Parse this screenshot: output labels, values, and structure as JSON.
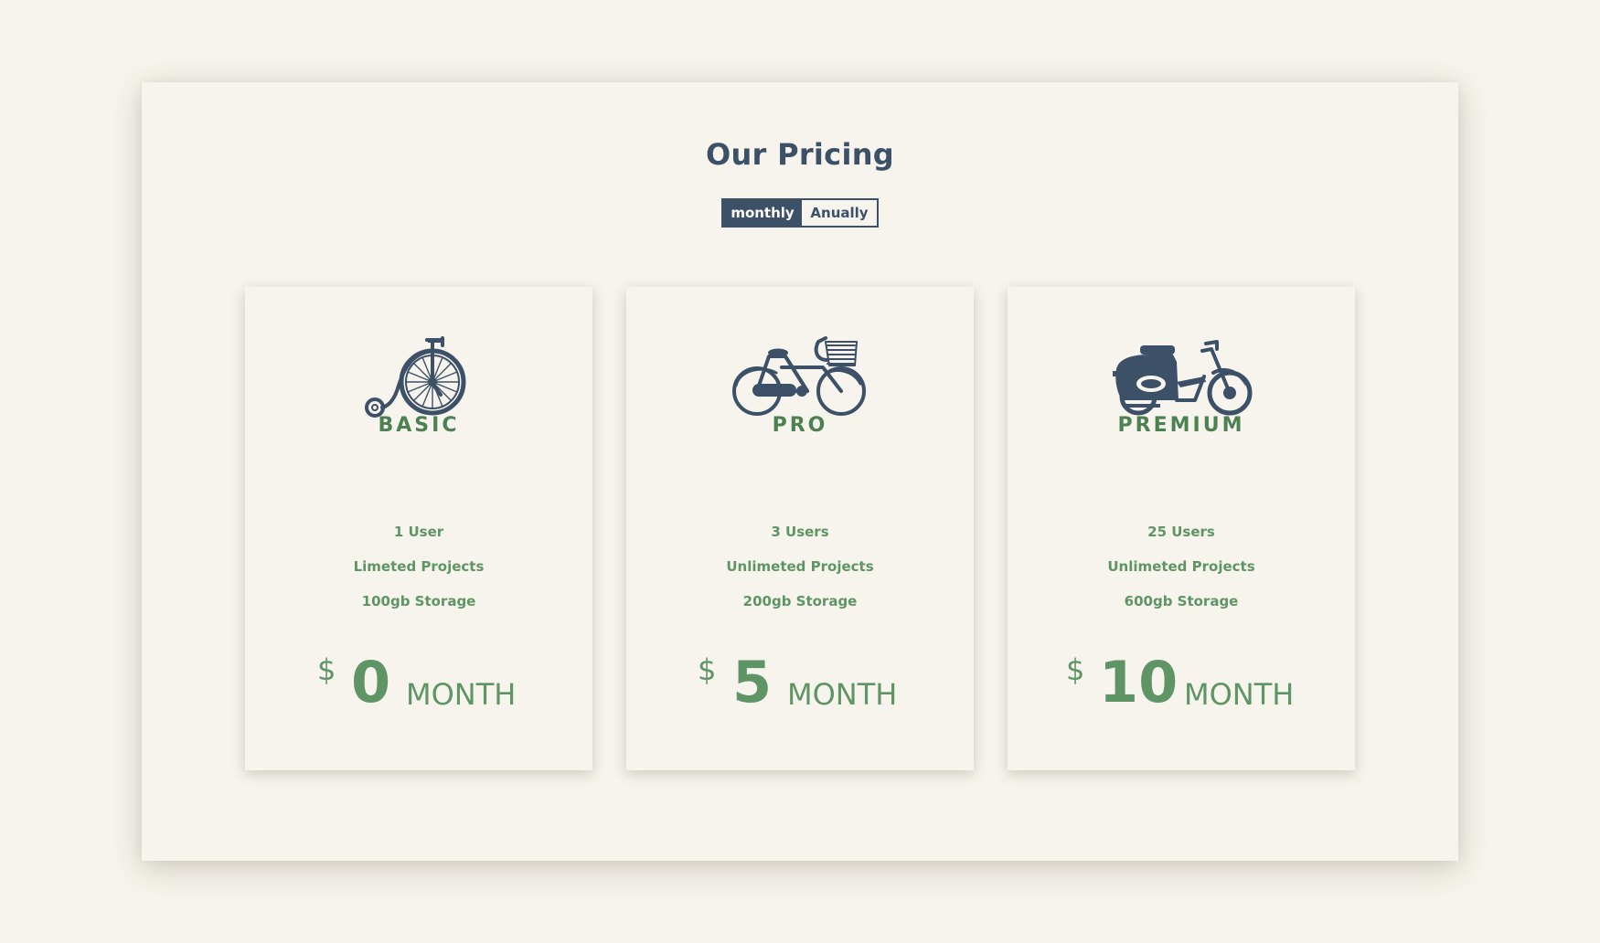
{
  "page": {
    "title": "Our Pricing"
  },
  "billing_toggle": {
    "monthly_label": "monthly",
    "annually_label": "Anually",
    "selected": "monthly"
  },
  "plans": [
    {
      "name": "BASIC",
      "icon": "penny-farthing-icon",
      "features": [
        "1 User",
        "Limeted Projects",
        "100gb Storage"
      ],
      "currency": "$",
      "price": "0",
      "period": "MONTH"
    },
    {
      "name": "PRO",
      "icon": "bicycle-icon",
      "features": [
        "3 Users",
        "Unlimeted Projects",
        "200gb Storage"
      ],
      "currency": "$",
      "price": "5",
      "period": "MONTH"
    },
    {
      "name": "PREMIUM",
      "icon": "scooter-icon",
      "features": [
        "25 Users",
        "Unlimeted Projects",
        "600gb Storage"
      ],
      "currency": "$",
      "price": "10",
      "period": "MONTH"
    }
  ],
  "colors": {
    "background": "#f6f4ec",
    "navy": "#3c5068",
    "green_dark": "#4c8151",
    "green": "#5f9565"
  }
}
